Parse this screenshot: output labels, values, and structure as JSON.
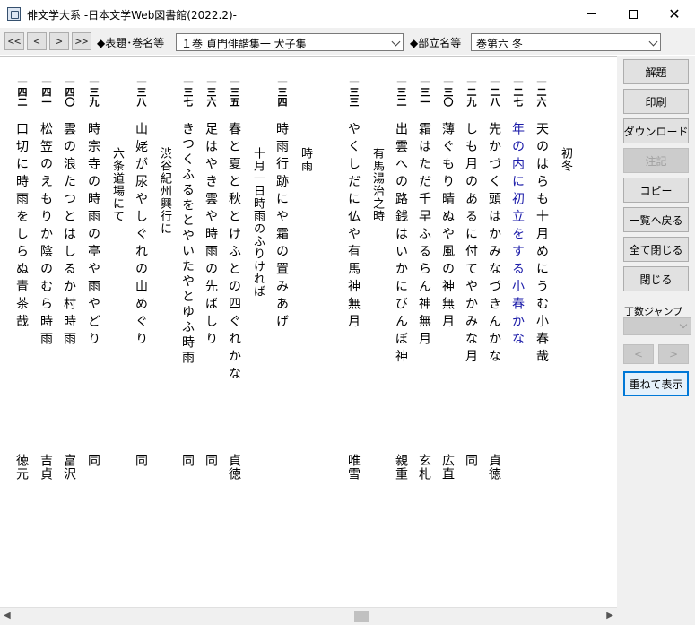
{
  "window": {
    "title": "俳文学大系 -日本文学Web図書館(2022.2)-",
    "minimize": "—",
    "maximize": "□",
    "close": "✕"
  },
  "toolbar": {
    "nav": [
      "<<",
      "<",
      ">",
      ">>"
    ],
    "volume_label": "◆表題･巻名等",
    "volume_value": "１巻 貞門俳諧集一 犬子集",
    "section_label": "◆部立名等",
    "section_value": "巻第六 冬"
  },
  "sidebar": {
    "buttons": [
      "解題",
      "印刷",
      "ダウンロード",
      "注記",
      "コピー",
      "一覧へ戻る",
      "全て閉じる",
      "閉じる"
    ],
    "page_jump_label": "丁数ジャンプ",
    "prev": "<",
    "next": ">",
    "stack_button": "重ねて表示"
  },
  "text": {
    "heading": "初冬",
    "col_1_num": "一二六",
    "col_1": "天のはらも十月めにうむ小春哉",
    "col_2_num": "一二七",
    "col_2": "年の内に初立をする小春かな",
    "col_3_num": "一二八",
    "col_3": "先かづく頭はかみなづきんかな",
    "col_3_author": "貞徳",
    "col_4_num": "一二九",
    "col_4": "しも月のあるに付てやかみな月",
    "col_4_author": "同",
    "col_5_num": "一三〇",
    "col_5": "薄ぐもり晴ぬや風の神無月",
    "col_5_author": "広直",
    "col_6_num": "一三一",
    "col_6": "霜はただ千早ふるらん神無月",
    "col_6_author": "玄札",
    "col_7_num": "一三二",
    "col_7": "出雲への路銭はいかにびんぼ神",
    "col_7_head": "有馬湯治之時",
    "col_7_author": "親重",
    "col_8_num": "一三三",
    "col_8": "やくしだに仏や有馬神無月",
    "col_8_author": "唯雪",
    "section_heading": "時雨",
    "col_9_num": "一三四",
    "col_9": "時雨行跡にや霜の置みあげ",
    "col_9_head": "十月一日時雨のふりければ",
    "col_10_num": "一三五",
    "col_10": "春と夏と秋とけふとの四ぐれかな",
    "col_10_author": "貞徳",
    "col_11_num": "一三六",
    "col_11": "足はやき雲や時雨の先ばしり",
    "col_11_author": "同",
    "col_12_num": "一三七",
    "col_12": "きつくふるをとやいたやとゆふ時雨",
    "col_12_author": "同",
    "col_13_num": "一三八",
    "col_13": "山姥が尿やしぐれの山めぐり",
    "col_13_head": "渋谷紀州興行に",
    "col_13_author": "同",
    "col_14_num": "一三九",
    "col_14": "時宗寺の時雨の亭や雨やどり",
    "col_14_head": "六条道場にて",
    "col_14_author": "同",
    "col_15_num": "一四〇",
    "col_15": "雲の浪たつとはしるか村時雨",
    "col_15_author": "富沢",
    "col_16_num": "一四一",
    "col_16": "松笠のえもりか陰のむら時雨",
    "col_16_author": "吉貞",
    "col_17_num": "一四二",
    "col_17": "口切に時雨をしらぬ青茶哉",
    "col_17_author": "徳元"
  }
}
